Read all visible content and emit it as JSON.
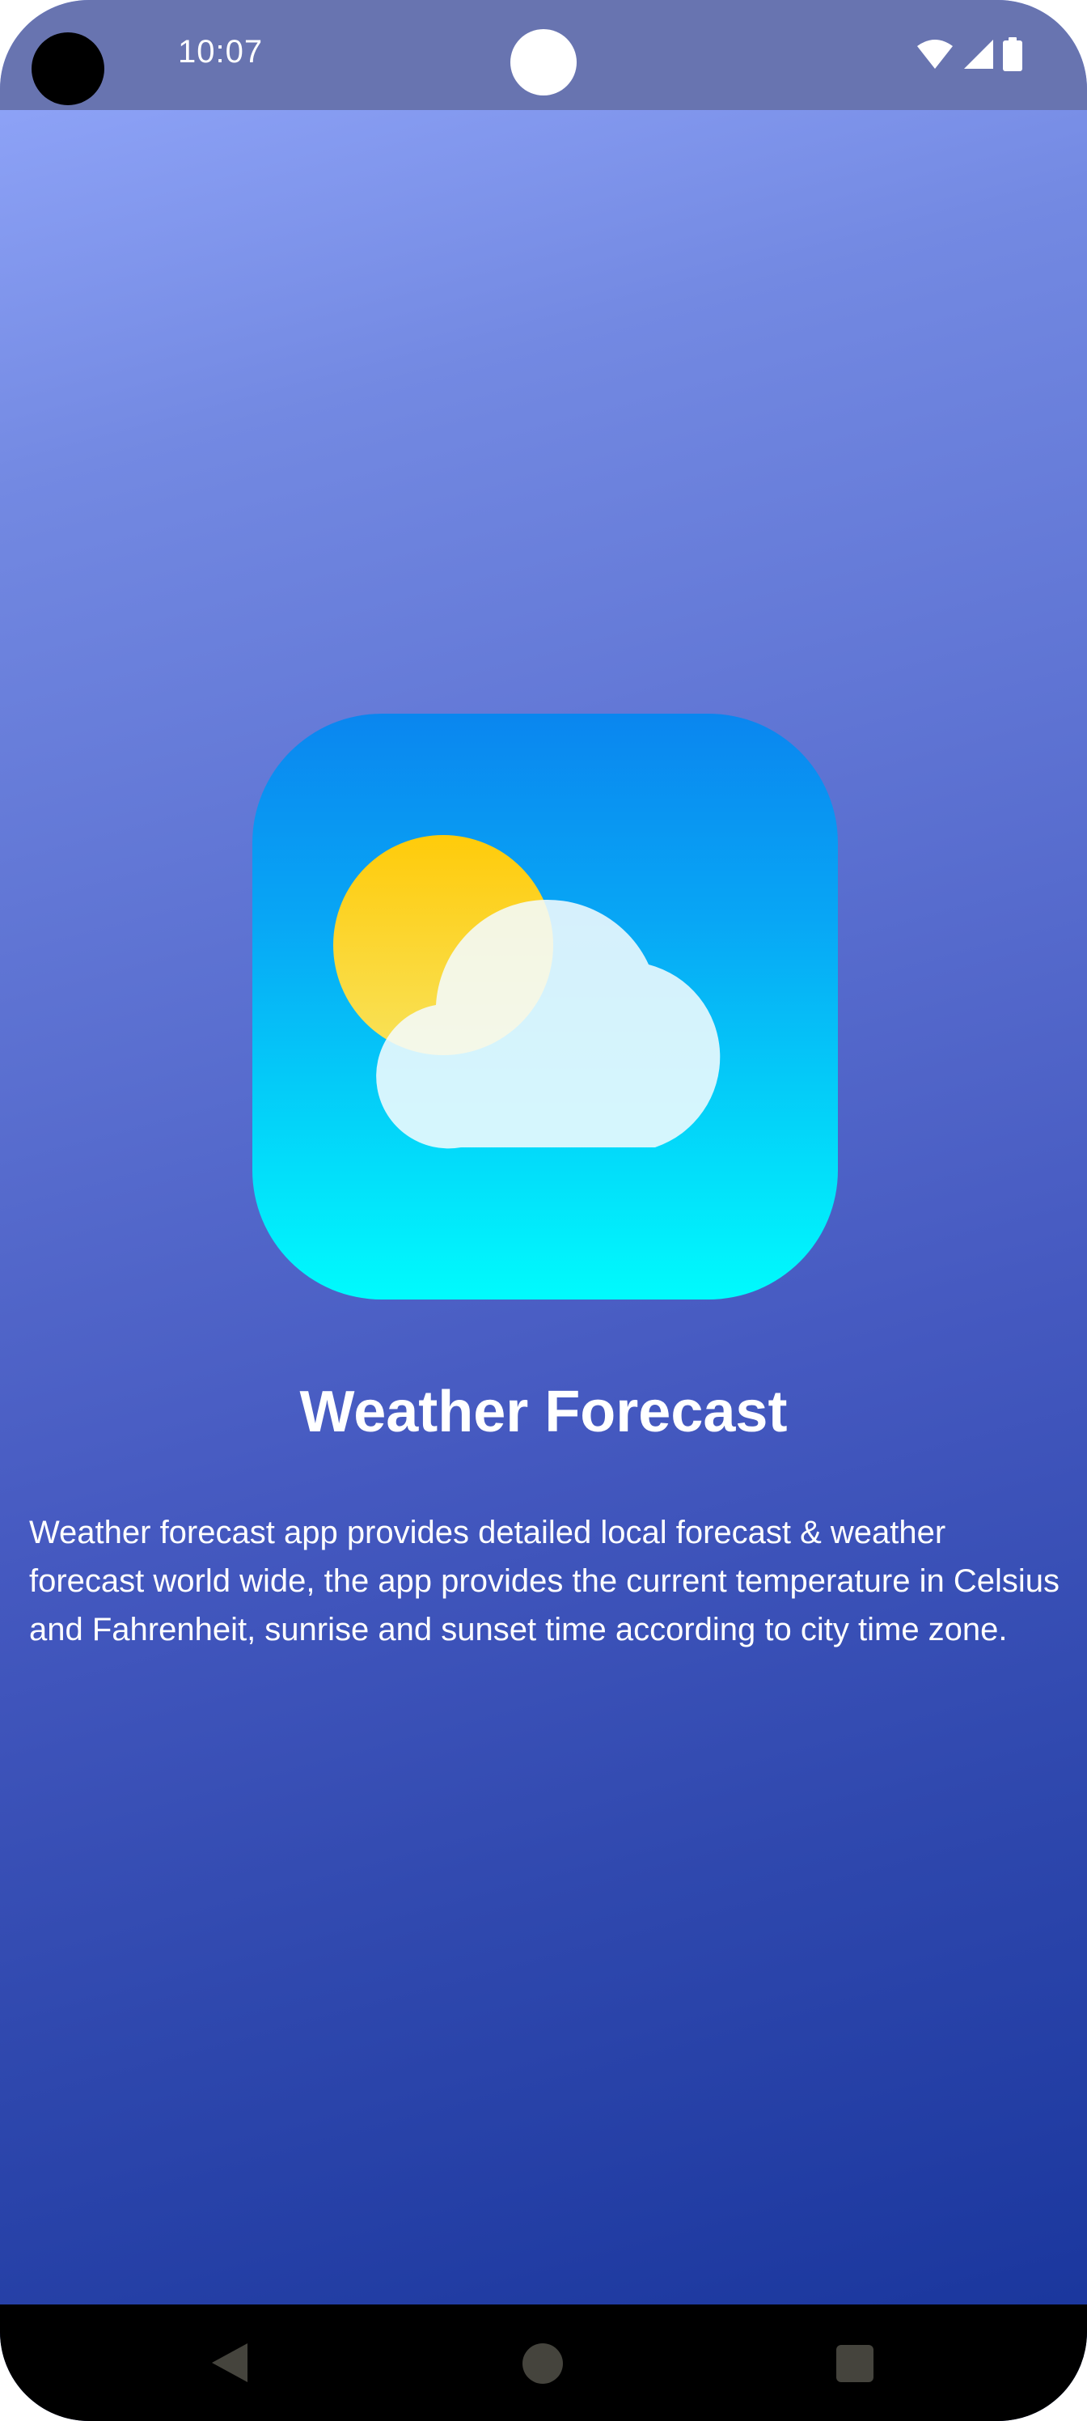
{
  "status_bar": {
    "time": "10:07",
    "icons": [
      "wifi-icon",
      "signal-icon",
      "battery-icon"
    ]
  },
  "app": {
    "icon": "weather-sun-cloud-icon",
    "title": "Weather Forecast",
    "description": "Weather forecast app provides detailed local forecast & weather forecast world wide, the app provides the current temperature in Celsius and Fahrenheit, sunrise and sunset time according to city time zone."
  },
  "nav_bar": {
    "buttons": [
      "back-icon",
      "home-icon",
      "recents-icon"
    ]
  },
  "colors": {
    "background_top": "#94a9fc",
    "background_bottom": "#16339a",
    "status_bar": "#6874b0",
    "icon_gradient_top": "#0a86ef",
    "icon_gradient_bottom": "#00fbfd",
    "sun": "#fdd017",
    "cloud": "#f3fbfd"
  }
}
